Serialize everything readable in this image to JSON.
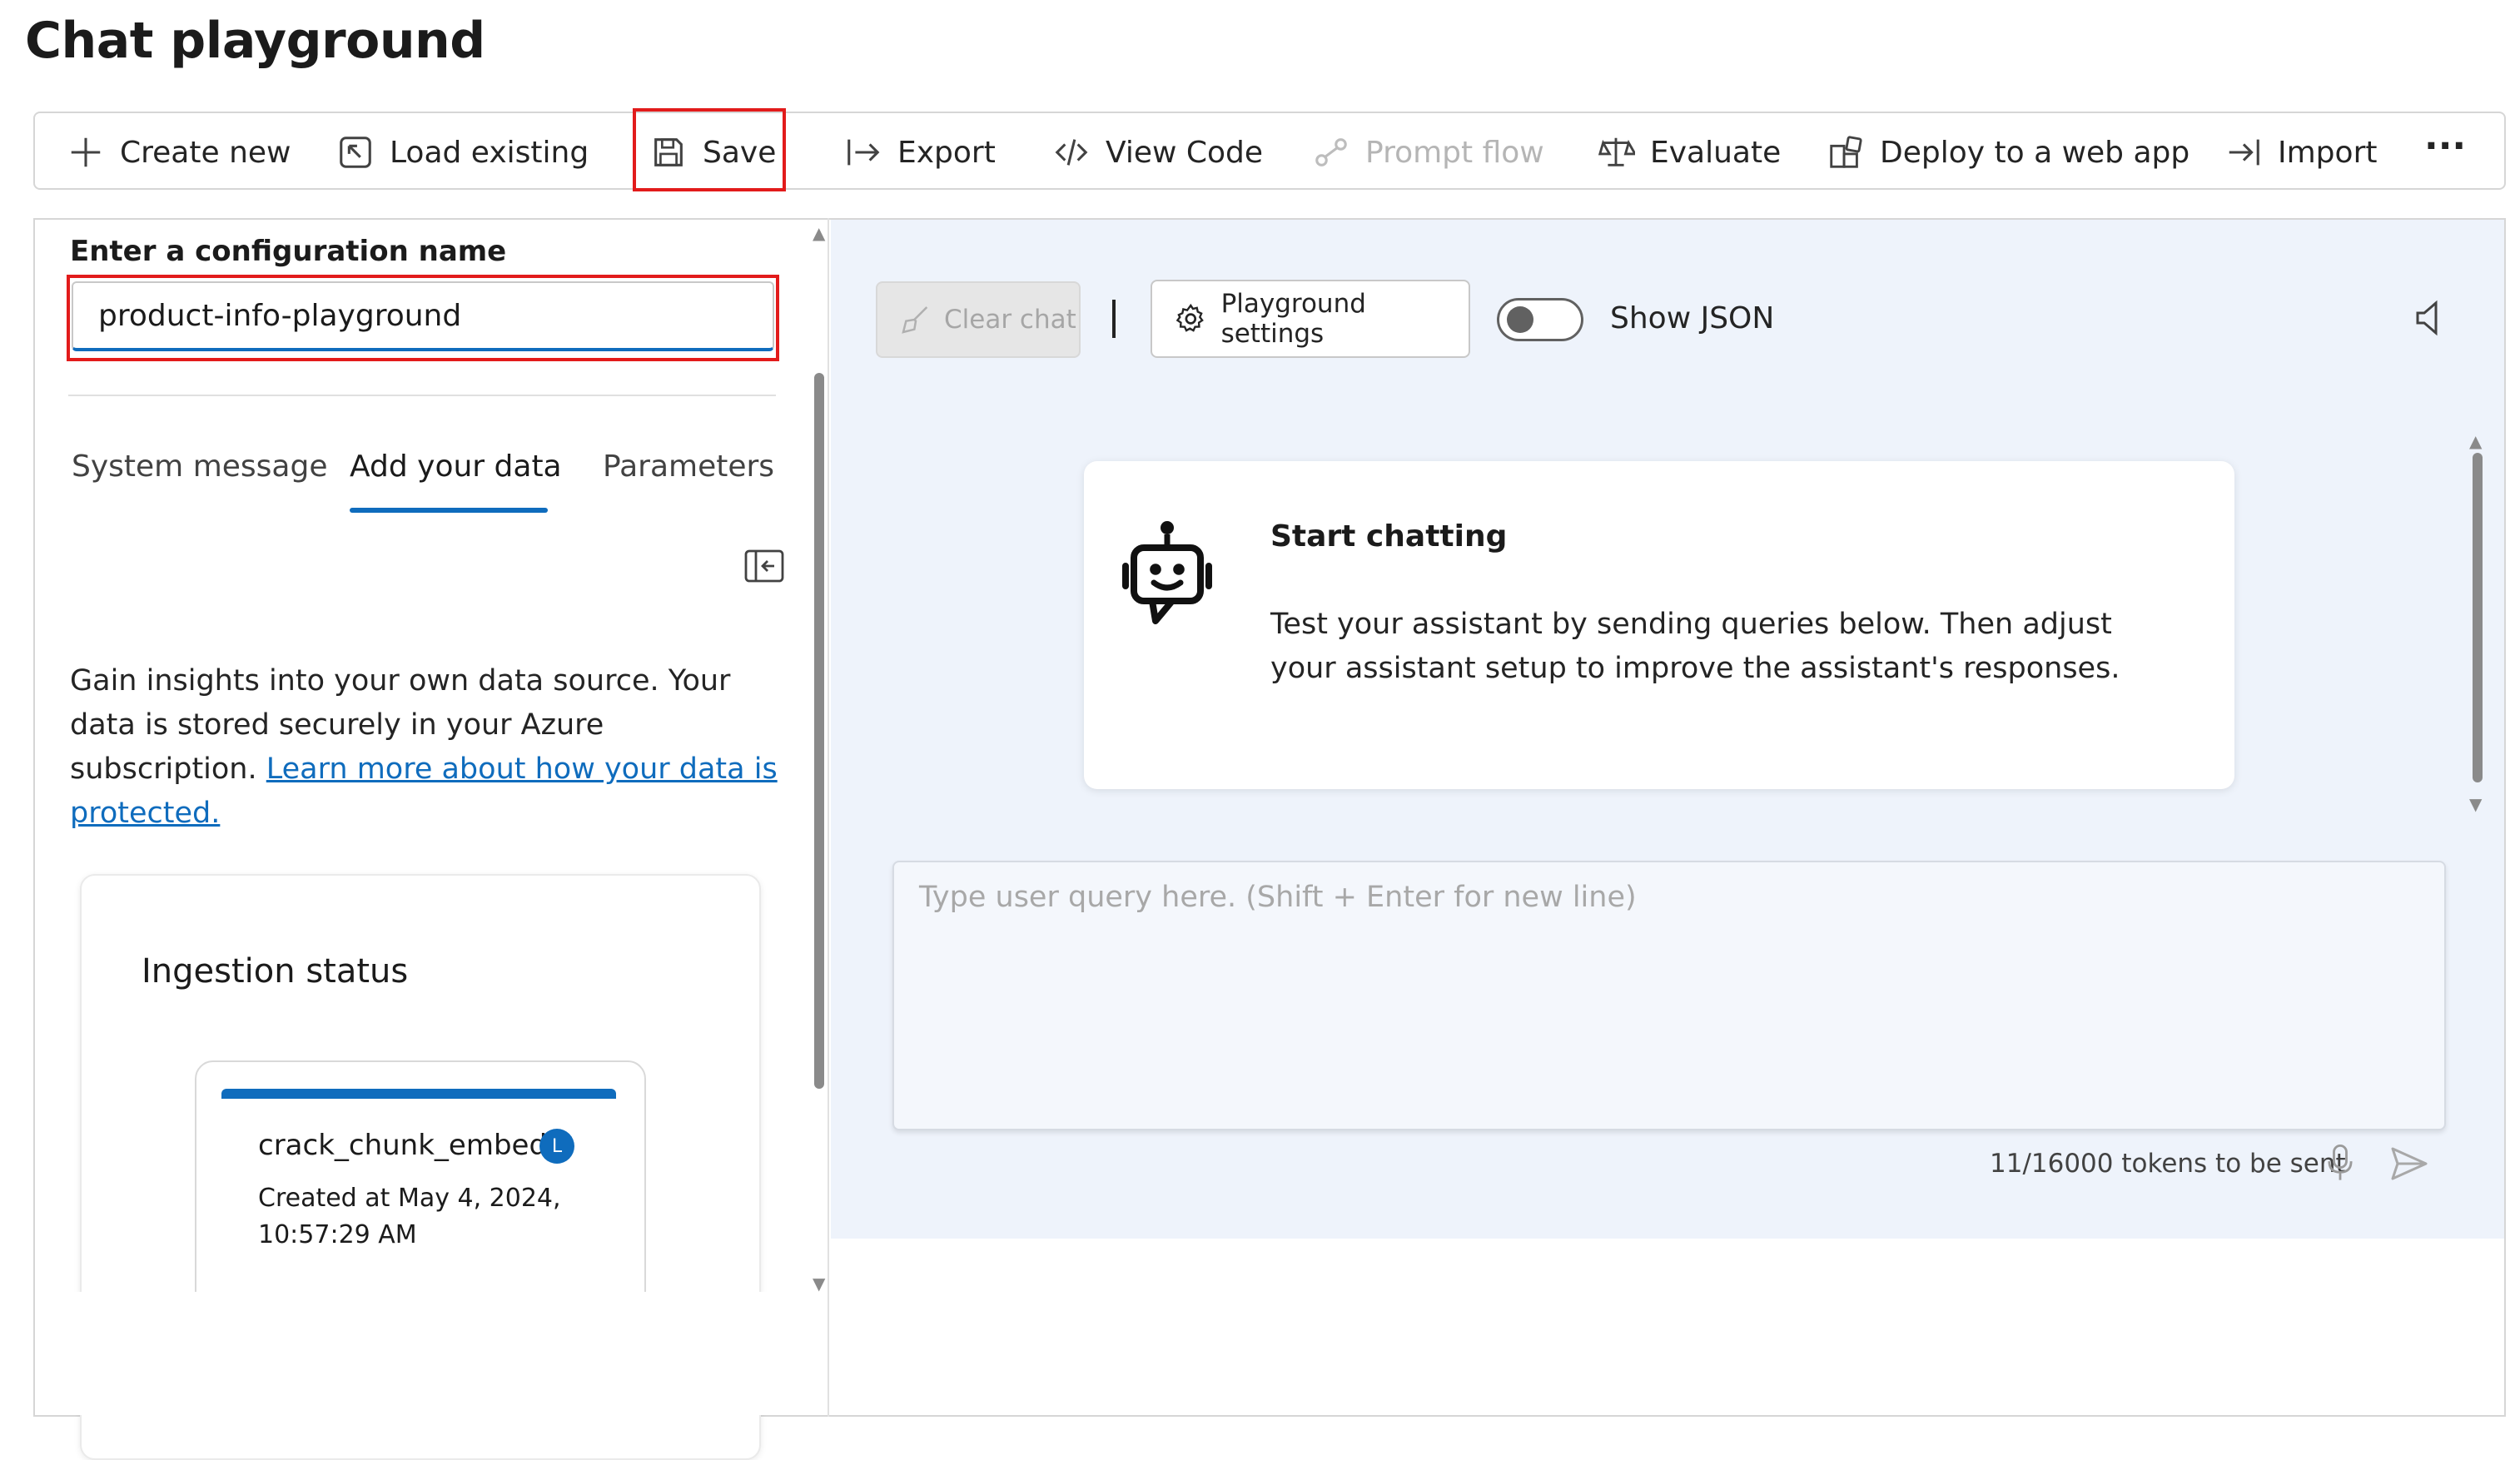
{
  "page": {
    "title": "Chat playground"
  },
  "toolbar": {
    "items": [
      {
        "label": "Create new",
        "icon": "plus-icon",
        "enabled": true
      },
      {
        "label": "Load existing",
        "icon": "load-icon",
        "enabled": true
      },
      {
        "label": "Save",
        "icon": "save-icon",
        "enabled": true,
        "highlighted": true
      },
      {
        "label": "Export",
        "icon": "export-icon",
        "enabled": true
      },
      {
        "label": "View Code",
        "icon": "code-icon",
        "enabled": true
      },
      {
        "label": "Prompt flow",
        "icon": "flow-icon",
        "enabled": false
      },
      {
        "label": "Evaluate",
        "icon": "scale-icon",
        "enabled": true
      },
      {
        "label": "Deploy to a web app",
        "icon": "deploy-icon",
        "enabled": true
      },
      {
        "label": "Import",
        "icon": "import-icon",
        "enabled": true
      }
    ],
    "more": "···"
  },
  "config": {
    "label": "Enter a configuration name",
    "value": "product-info-playground"
  },
  "tabs": [
    {
      "label": "System message",
      "active": false
    },
    {
      "label": "Add your data",
      "active": true
    },
    {
      "label": "Parameters",
      "active": false
    }
  ],
  "data_section": {
    "description": "Gain insights into your own data source. Your data is stored securely in your Azure subscription. ",
    "link": "Learn more about how your data is protected."
  },
  "ingestion": {
    "title": "Ingestion status",
    "job_name": "crack_chunk_embed",
    "status_glyph": "L",
    "created": "Created at May 4, 2024, 10:57:29 AM"
  },
  "chat": {
    "clear_label": "Clear chat",
    "settings_label": "Playground settings",
    "show_json_label": "Show JSON",
    "show_json_on": false,
    "start_title": "Start chatting",
    "start_body": "Test your assistant by sending queries below. Then adjust your assistant setup to improve the assistant's responses.",
    "input_placeholder": "Type user query here. (Shift + Enter for new line)",
    "tokens": "11/16000 tokens to be sent"
  },
  "colors": {
    "accent": "#0f6cbd",
    "highlight": "#e21b1b",
    "chat_bg": "#eef3fb"
  }
}
